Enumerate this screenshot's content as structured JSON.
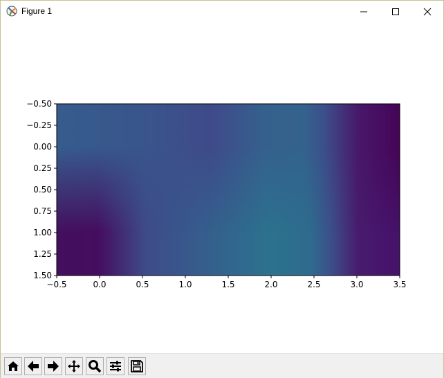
{
  "window": {
    "title": "Figure 1"
  },
  "controls": {
    "minimize": "minimize-icon",
    "maximize": "maximize-icon",
    "close": "close-icon"
  },
  "chart_data": {
    "type": "heatmap",
    "title": "",
    "xlabel": "",
    "ylabel": "",
    "xlim": [
      -0.5,
      3.5
    ],
    "ylim": [
      1.5,
      -0.5
    ],
    "y_inverted": true,
    "colormap": "viridis",
    "interpolation": "bilinear",
    "x_ticks": [
      -0.5,
      0.0,
      0.5,
      1.0,
      1.5,
      2.0,
      2.5,
      3.0,
      3.5
    ],
    "x_tick_labels": [
      "−0.5",
      "0.0",
      "0.5",
      "1.0",
      "1.5",
      "2.0",
      "2.5",
      "3.0",
      "3.5"
    ],
    "y_ticks": [
      -0.5,
      -0.25,
      0.0,
      0.25,
      0.5,
      0.75,
      1.0,
      1.25,
      1.5
    ],
    "y_tick_labels": [
      "−0.50",
      "−0.25",
      "0.00",
      "0.25",
      "0.50",
      "0.75",
      "1.00",
      "1.25",
      "1.50"
    ],
    "columns": [
      0,
      1,
      2,
      3
    ],
    "rows": [
      0,
      1
    ],
    "values": [
      [
        0.28,
        0.22,
        0.28,
        0.02
      ],
      [
        0.06,
        0.3,
        0.36,
        0.06
      ]
    ],
    "grid": false
  },
  "toolbar": {
    "buttons": [
      {
        "name": "home-button",
        "icon": "home-icon"
      },
      {
        "name": "back-button",
        "icon": "back-arrow-icon"
      },
      {
        "name": "forward-button",
        "icon": "forward-arrow-icon"
      },
      {
        "name": "pan-button",
        "icon": "move-icon"
      },
      {
        "name": "zoom-button",
        "icon": "magnifier-icon"
      },
      {
        "name": "configure-subplots-button",
        "icon": "sliders-icon"
      },
      {
        "name": "save-button",
        "icon": "save-icon"
      }
    ]
  }
}
